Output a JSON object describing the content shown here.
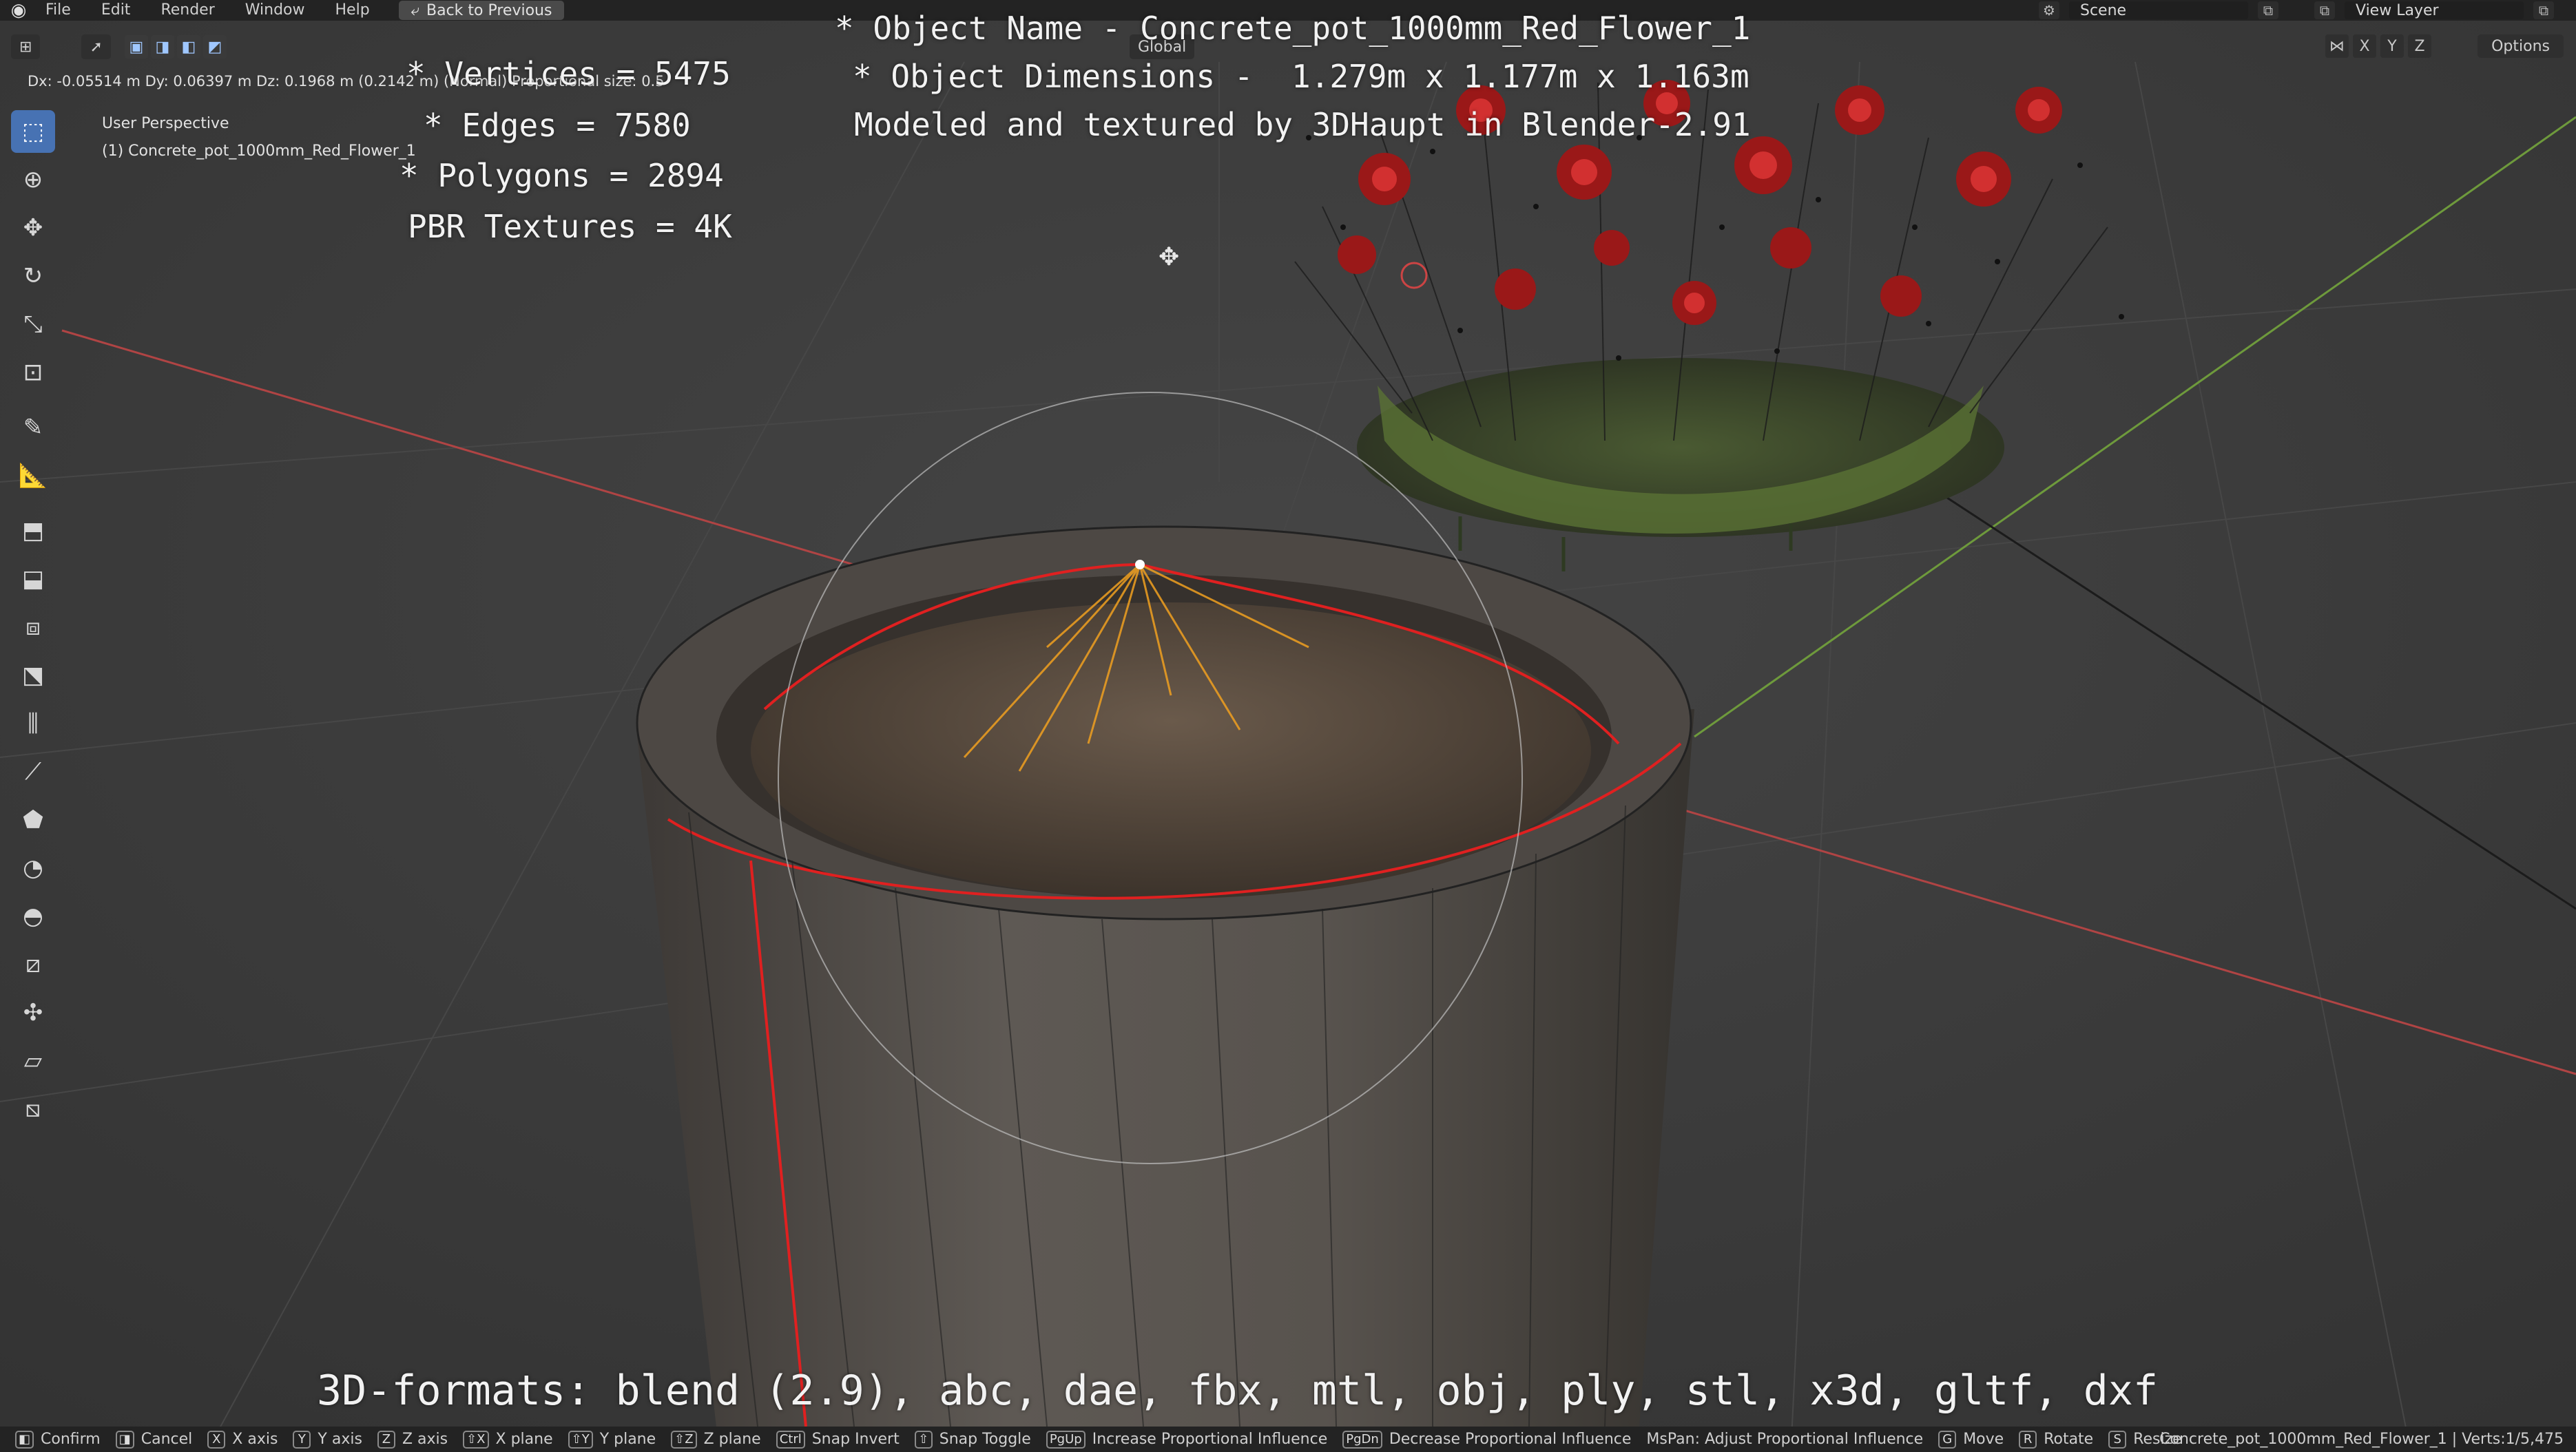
{
  "menu": {
    "items": [
      "File",
      "Edit",
      "Render",
      "Window",
      "Help"
    ],
    "back_button": "Back to Previous",
    "scene_label": "Scene",
    "view_layer_label": "View Layer"
  },
  "header": {
    "transform_space": "Global",
    "axis_buttons": [
      "X",
      "Y",
      "Z"
    ],
    "options_label": "Options"
  },
  "viewport": {
    "transform_readout": "Dx: -0.05514 m  Dy: 0.06397 m  Dz: 0.1968 m (0.2142 m) (Normal)  Proportional size: 0.5",
    "view_name": "User Perspective",
    "object_label": "(1) Concrete_pot_1000mm_Red_Flower_1"
  },
  "overlay": {
    "vertices": "* Vertices = 5475",
    "edges": "* Edges = 7580",
    "polygons": "* Polygons = 2894",
    "textures": "PBR Textures = 4K",
    "object_name": "* Object Name - Concrete_pot_1000mm_Red_Flower_1",
    "object_dimensions": "* Object Dimensions -  1.279m x 1.177m x 1.163m",
    "modeled_by": "Modeled and textured by 3DHaupt in Blender-2.91",
    "formats": "3D-formats: blend (2.9), abc, dae, fbx, mtl, obj, ply, stl, x3d, gltf, dxf"
  },
  "toolbar": {
    "tools": [
      "select-box-tool",
      "cursor-tool",
      "move-tool",
      "rotate-tool",
      "scale-tool",
      "transform-tool",
      "annotate-tool",
      "measure-tool",
      "add-cube-tool",
      "extrude-tool",
      "inset-tool",
      "bevel-tool",
      "loop-cut-tool",
      "knife-tool",
      "poly-build-tool",
      "spin-tool",
      "smooth-tool",
      "edge-slide-tool",
      "shrink-fatten-tool",
      "shear-tool",
      "rip-region-tool"
    ]
  },
  "statusbar": {
    "hints": [
      {
        "key": "",
        "label": "Confirm"
      },
      {
        "key": "",
        "label": "Cancel"
      },
      {
        "key": "X",
        "label": "X axis"
      },
      {
        "key": "Y",
        "label": "Y axis"
      },
      {
        "key": "Z",
        "label": "Z axis"
      },
      {
        "key": "⇧X",
        "label": "X plane"
      },
      {
        "key": "⇧Y",
        "label": "Y plane"
      },
      {
        "key": "⇧Z",
        "label": "Z plane"
      },
      {
        "key": "Ctrl",
        "label": "Snap Invert"
      },
      {
        "key": "⇧",
        "label": "Snap Toggle"
      },
      {
        "key": "PgUp",
        "label": "Increase Proportional Influence"
      },
      {
        "key": "PgDn",
        "label": "Decrease Proportional Influence"
      },
      {
        "key": "",
        "label": "MsPan: Adjust Proportional Influence"
      },
      {
        "key": "G",
        "label": "Move"
      },
      {
        "key": "R",
        "label": "Rotate"
      },
      {
        "key": "S",
        "label": "Resize"
      }
    ],
    "right_info": "Concrete_pot_1000mm_Red_Flower_1 | Verts:1/5,475"
  },
  "colors": {
    "viewport_bg": "#3b3b3b",
    "active_tool": "#4772b3",
    "x_axis": "#b04444",
    "y_axis": "#6e9a3c",
    "seam_edge": "#e02020",
    "selected_edges": "#f0a020"
  }
}
